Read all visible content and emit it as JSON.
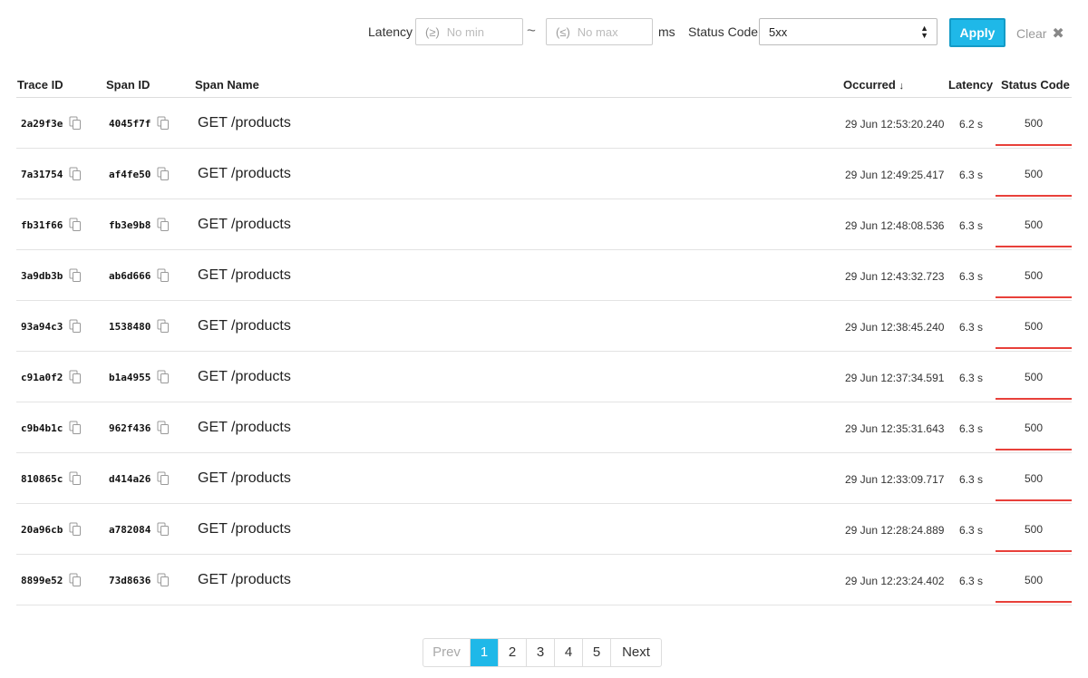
{
  "filters": {
    "latency_label": "Latency",
    "min_prefix": "(≥)",
    "min_placeholder": "No min",
    "range_separator": "~",
    "max_prefix": "(≤)",
    "max_placeholder": "No max",
    "unit": "ms",
    "status_label": "Status Code",
    "status_value": "5xx",
    "apply_label": "Apply",
    "clear_label": "Clear",
    "clear_icon": "✖"
  },
  "table": {
    "columns": {
      "trace_id": "Trace ID",
      "span_id": "Span ID",
      "span_name": "Span Name",
      "occurred": "Occurred",
      "occurred_sort_icon": "↓",
      "latency": "Latency",
      "status_code": "Status Code"
    },
    "rows": [
      {
        "trace_id": "2a29f3e",
        "span_id": "4045f7f",
        "span_name": "GET /products",
        "occurred": "29 Jun 12:53:20.240",
        "latency": "6.2 s",
        "status": "500"
      },
      {
        "trace_id": "7a31754",
        "span_id": "af4fe50",
        "span_name": "GET /products",
        "occurred": "29 Jun 12:49:25.417",
        "latency": "6.3 s",
        "status": "500"
      },
      {
        "trace_id": "fb31f66",
        "span_id": "fb3e9b8",
        "span_name": "GET /products",
        "occurred": "29 Jun 12:48:08.536",
        "latency": "6.3 s",
        "status": "500"
      },
      {
        "trace_id": "3a9db3b",
        "span_id": "ab6d666",
        "span_name": "GET /products",
        "occurred": "29 Jun 12:43:32.723",
        "latency": "6.3 s",
        "status": "500"
      },
      {
        "trace_id": "93a94c3",
        "span_id": "1538480",
        "span_name": "GET /products",
        "occurred": "29 Jun 12:38:45.240",
        "latency": "6.3 s",
        "status": "500"
      },
      {
        "trace_id": "c91a0f2",
        "span_id": "b1a4955",
        "span_name": "GET /products",
        "occurred": "29 Jun 12:37:34.591",
        "latency": "6.3 s",
        "status": "500"
      },
      {
        "trace_id": "c9b4b1c",
        "span_id": "962f436",
        "span_name": "GET /products",
        "occurred": "29 Jun 12:35:31.643",
        "latency": "6.3 s",
        "status": "500"
      },
      {
        "trace_id": "810865c",
        "span_id": "d414a26",
        "span_name": "GET /products",
        "occurred": "29 Jun 12:33:09.717",
        "latency": "6.3 s",
        "status": "500"
      },
      {
        "trace_id": "20a96cb",
        "span_id": "a782084",
        "span_name": "GET /products",
        "occurred": "29 Jun 12:28:24.889",
        "latency": "6.3 s",
        "status": "500"
      },
      {
        "trace_id": "8899e52",
        "span_id": "73d8636",
        "span_name": "GET /products",
        "occurred": "29 Jun 12:23:24.402",
        "latency": "6.3 s",
        "status": "500"
      }
    ]
  },
  "pagination": {
    "prev": "Prev",
    "pages": [
      "1",
      "2",
      "3",
      "4",
      "5"
    ],
    "current": "1",
    "next": "Next"
  },
  "colors": {
    "accent": "#1fb8e8",
    "error_underline": "#e8403a"
  },
  "icons": {
    "copy": "copy-icon",
    "select_caret": "chevron-updown-icon",
    "sort": "sort-desc-icon"
  }
}
